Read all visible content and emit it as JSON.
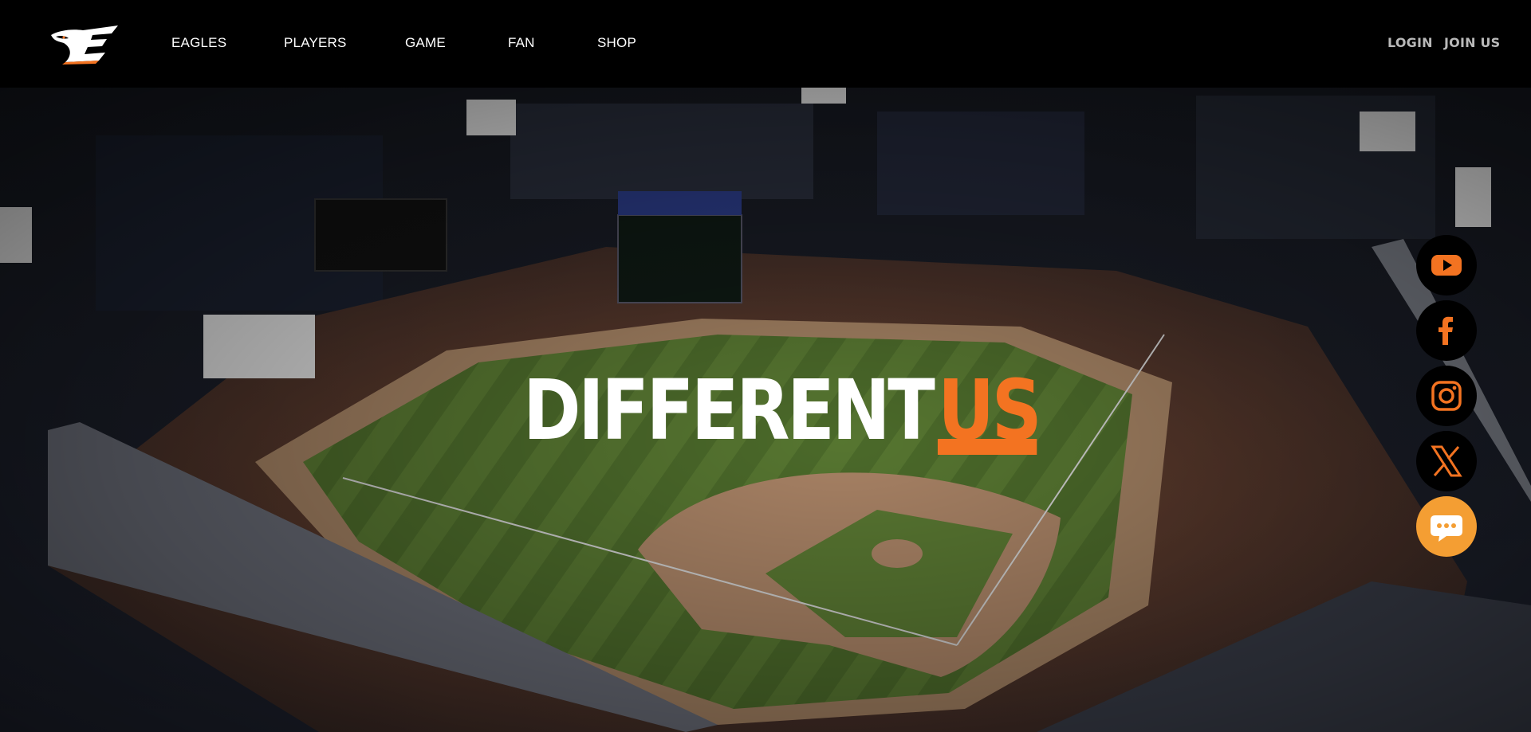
{
  "header": {
    "logo_name": "eagles-logo",
    "nav": [
      {
        "label": "EAGLES"
      },
      {
        "label": "PLAYERS"
      },
      {
        "label": "GAME"
      },
      {
        "label": "FAN"
      },
      {
        "label": "SHOP"
      }
    ],
    "login_label": "LOGIN",
    "join_label": "JOIN US"
  },
  "hero": {
    "headline_white": "DIFFERENT",
    "headline_orange": "US",
    "background": "aerial night view of Eagles Park baseball stadium"
  },
  "social": [
    {
      "icon": "youtube-icon",
      "name": "YouTube"
    },
    {
      "icon": "facebook-icon",
      "name": "Facebook"
    },
    {
      "icon": "instagram-icon",
      "name": "Instagram"
    },
    {
      "icon": "x-icon",
      "name": "X"
    },
    {
      "icon": "chat-icon",
      "name": "Chat"
    }
  ],
  "colors": {
    "accent": "#f37321",
    "chat": "#f49e33",
    "header_bg": "#000000",
    "nav_text": "#ffffff",
    "auth_text": "#b9b9b9"
  }
}
